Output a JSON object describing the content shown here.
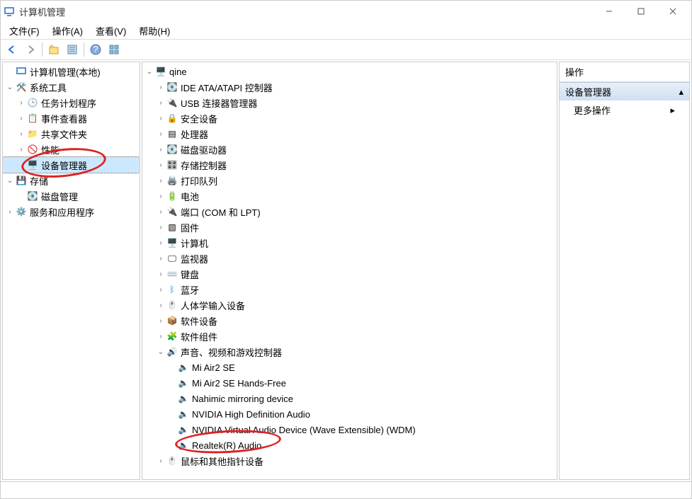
{
  "window": {
    "title": "计算机管理"
  },
  "menu": {
    "file": "文件(F)",
    "action": "操作(A)",
    "view": "查看(V)",
    "help": "帮助(H)"
  },
  "leftTree": {
    "root": "计算机管理(本地)",
    "systools": "系统工具",
    "tasksched": "任务计划程序",
    "eventviewer": "事件查看器",
    "sharedfolders": "共享文件夹",
    "perf": "性能",
    "devmgr": "设备管理器",
    "storage": "存储",
    "diskmgmt": "磁盘管理",
    "services": "服务和应用程序"
  },
  "deviceRoot": "qine",
  "categories": {
    "ide": "IDE ATA/ATAPI 控制器",
    "usb": "USB 连接器管理器",
    "security": "安全设备",
    "cpu": "处理器",
    "disk": "磁盘驱动器",
    "storagectrl": "存储控制器",
    "printqueue": "打印队列",
    "battery": "电池",
    "ports": "端口 (COM 和 LPT)",
    "firmware": "固件",
    "computer": "计算机",
    "monitor": "监视器",
    "keyboard": "键盘",
    "bluetooth": "蓝牙",
    "hid": "人体学输入设备",
    "swdev": "软件设备",
    "swcomp": "软件组件",
    "sound": "声音、视频和游戏控制器",
    "mouse": "鼠标和其他指针设备"
  },
  "soundDevices": {
    "d1": "Mi Air2 SE",
    "d2": "Mi Air2 SE Hands-Free",
    "d3": "Nahimic mirroring device",
    "d4": "NVIDIA High Definition Audio",
    "d5": "NVIDIA Virtual Audio Device (Wave Extensible) (WDM)",
    "d6": "Realtek(R) Audio"
  },
  "actions": {
    "header": "操作",
    "devmgr": "设备管理器",
    "more": "更多操作"
  }
}
